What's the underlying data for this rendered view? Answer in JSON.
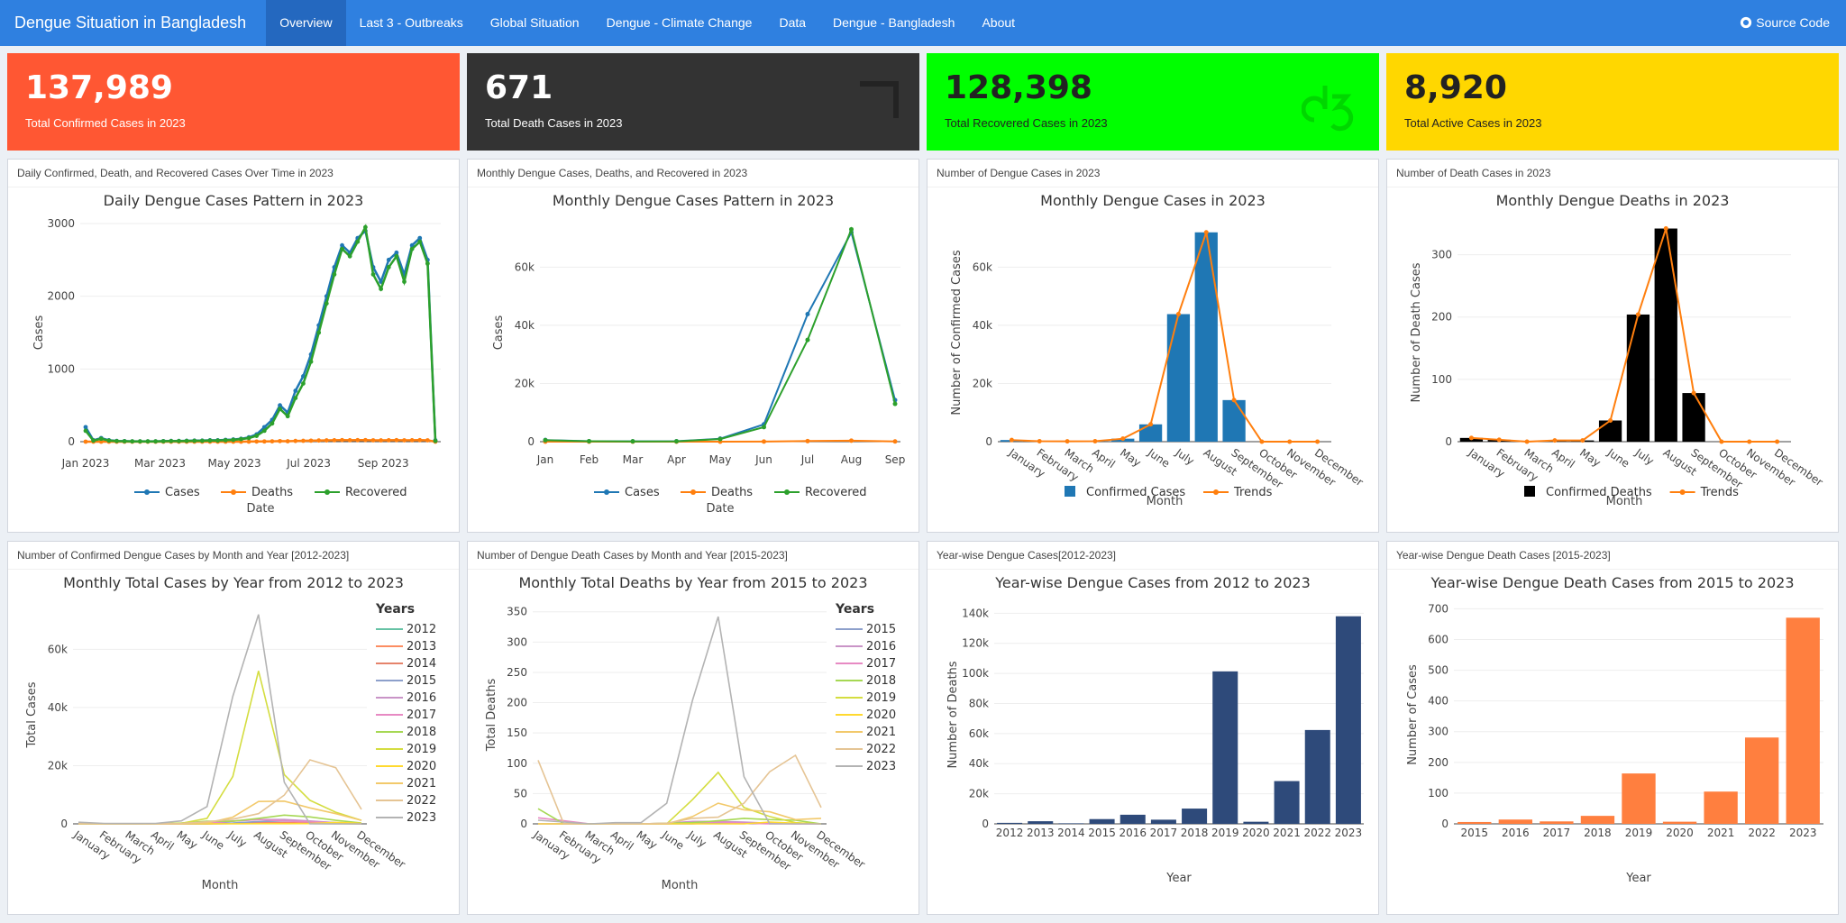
{
  "nav": {
    "brand": "Dengue Situation in Bangladesh",
    "items": [
      "Overview",
      "Last 3 - Outbreaks",
      "Global Situation",
      "Dengue - Climate Change",
      "Data",
      "Dengue - Bangladesh",
      "About"
    ],
    "source": "Source Code"
  },
  "value_boxes": [
    {
      "value": "137,989",
      "label": "Total Confirmed Cases in 2023",
      "color": "#ff5733"
    },
    {
      "value": "671",
      "label": "Total Death Cases in 2023",
      "color": "#333333"
    },
    {
      "value": "128,398",
      "label": "Total Recovered Cases in 2023",
      "color": "#00ff00"
    },
    {
      "value": "8,920",
      "label": "Total Active Cases in 2023",
      "color": "#ffd700"
    }
  ],
  "panels": [
    "Daily Confirmed, Death, and Recovered Cases Over Time in 2023",
    "Monthly Dengue Cases, Deaths, and Recovered in 2023",
    "Number of Dengue Cases in 2023",
    "Number of Death Cases in 2023",
    "Number of Confirmed Dengue Cases by Month and Year [2012-2023]",
    "Number of Dengue Death Cases by Month and Year [2015-2023]",
    "Year-wise Dengue Cases[2012-2023]",
    "Year-wise Dengue Death Cases [2015-2023]"
  ],
  "chart_data": [
    {
      "type": "line",
      "title": "Daily Dengue Cases Pattern in 2023",
      "xlabel": "Date",
      "ylabel": "Cases",
      "x_ticks": [
        "Jan 2023",
        "Mar 2023",
        "May 2023",
        "Jul 2023",
        "Sep 2023"
      ],
      "ylim": [
        0,
        3000
      ],
      "y_ticks": [
        0,
        1000,
        2000,
        3000
      ],
      "series": [
        {
          "name": "Cases",
          "color": "#1f77b4",
          "values": [
            200,
            20,
            50,
            20,
            10,
            8,
            5,
            5,
            5,
            5,
            8,
            10,
            10,
            12,
            15,
            15,
            20,
            20,
            25,
            30,
            40,
            60,
            100,
            200,
            300,
            500,
            400,
            700,
            900,
            1200,
            1600,
            2000,
            2400,
            2700,
            2600,
            2800,
            2900,
            2400,
            2200,
            2500,
            2600,
            2300,
            2700,
            2800,
            2500,
            20
          ]
        },
        {
          "name": "Deaths",
          "color": "#ff7f0e",
          "values": [
            0,
            0,
            0,
            0,
            0,
            0,
            0,
            0,
            0,
            0,
            0,
            0,
            0,
            0,
            0,
            0,
            0,
            0,
            0,
            0,
            0,
            1,
            2,
            3,
            5,
            8,
            6,
            10,
            12,
            14,
            16,
            18,
            20,
            22,
            20,
            21,
            22,
            19,
            18,
            20,
            21,
            19,
            20,
            21,
            19,
            0
          ]
        },
        {
          "name": "Recovered",
          "color": "#2ca02c",
          "values": [
            150,
            15,
            40,
            15,
            8,
            6,
            4,
            4,
            4,
            4,
            6,
            8,
            8,
            10,
            12,
            12,
            15,
            15,
            20,
            25,
            35,
            50,
            80,
            150,
            250,
            450,
            350,
            600,
            800,
            1100,
            1500,
            1900,
            2300,
            2650,
            2550,
            2750,
            2950,
            2300,
            2100,
            2400,
            2550,
            2200,
            2650,
            2750,
            2450,
            10
          ]
        }
      ]
    },
    {
      "type": "line",
      "title": "Monthly Dengue Cases Pattern in 2023",
      "xlabel": "Date",
      "ylabel": "Cases",
      "categories": [
        "Jan",
        "Feb",
        "Mar",
        "Apr",
        "May",
        "Jun",
        "Jul",
        "Aug",
        "Sep"
      ],
      "ylim": [
        0,
        75000
      ],
      "y_ticks": [
        "0",
        "20k",
        "40k",
        "60k"
      ],
      "series": [
        {
          "name": "Cases",
          "color": "#1f77b4",
          "values": [
            566,
            166,
            111,
            143,
            1036,
            5956,
            43854,
            71976,
            14300
          ]
        },
        {
          "name": "Deaths",
          "color": "#ff7f0e",
          "values": [
            6,
            3,
            0,
            2,
            2,
            34,
            204,
            342,
            78
          ]
        },
        {
          "name": "Recovered",
          "color": "#2ca02c",
          "values": [
            500,
            150,
            100,
            130,
            900,
            5000,
            35000,
            73000,
            13000
          ]
        }
      ]
    },
    {
      "type": "bar",
      "title": "Monthly Dengue Cases in 2023",
      "xlabel": "Month",
      "ylabel": "Number of Confirmed Cases",
      "categories": [
        "January",
        "February",
        "March",
        "April",
        "May",
        "June",
        "July",
        "August",
        "September",
        "October",
        "November",
        "December"
      ],
      "ylim": [
        0,
        75000
      ],
      "y_ticks": [
        "0",
        "20k",
        "40k",
        "60k"
      ],
      "values": [
        566,
        166,
        111,
        143,
        1036,
        5956,
        43854,
        71976,
        14300,
        0,
        0,
        0
      ],
      "bar_color": "#1f77b4",
      "trend_color": "#ff7f0e",
      "legend": [
        "Confirmed Cases",
        "Trends"
      ]
    },
    {
      "type": "bar",
      "title": "Monthly Dengue Deaths in 2023",
      "xlabel": "Month",
      "ylabel": "Number of Death Cases",
      "categories": [
        "January",
        "February",
        "March",
        "April",
        "May",
        "June",
        "July",
        "August",
        "September",
        "October",
        "November",
        "December"
      ],
      "ylim": [
        0,
        350
      ],
      "y_ticks": [
        "0",
        "100",
        "200",
        "300"
      ],
      "values": [
        6,
        3,
        0,
        2,
        2,
        34,
        204,
        342,
        78,
        0,
        0,
        0
      ],
      "bar_color": "#000000",
      "trend_color": "#ff7f0e",
      "legend": [
        "Confirmed Deaths",
        "Trends"
      ]
    },
    {
      "type": "line",
      "title": "Monthly Total Cases by Year from 2012 to 2023",
      "xlabel": "Month",
      "ylabel": "Total Cases",
      "legend_title": "Years",
      "categories": [
        "January",
        "February",
        "March",
        "April",
        "May",
        "June",
        "July",
        "August",
        "September",
        "October",
        "November",
        "December"
      ],
      "ylim": [
        0,
        75000
      ],
      "y_ticks": [
        "0",
        "20k",
        "40k",
        "60k"
      ],
      "series": [
        {
          "name": "2012",
          "color": "#66c2a5",
          "values": [
            0,
            0,
            0,
            0,
            0,
            0,
            100,
            300,
            200,
            100,
            50,
            20
          ]
        },
        {
          "name": "2013",
          "color": "#fc8d62",
          "values": [
            0,
            0,
            0,
            0,
            0,
            50,
            200,
            500,
            400,
            300,
            100,
            50
          ]
        },
        {
          "name": "2014",
          "color": "#e5836b",
          "values": [
            0,
            0,
            0,
            0,
            0,
            20,
            100,
            200,
            150,
            100,
            50,
            10
          ]
        },
        {
          "name": "2015",
          "color": "#8da0cb",
          "values": [
            0,
            0,
            0,
            0,
            10,
            30,
            300,
            800,
            1000,
            800,
            400,
            100
          ]
        },
        {
          "name": "2016",
          "color": "#c994c7",
          "values": [
            0,
            0,
            0,
            0,
            20,
            200,
            900,
            1500,
            1500,
            1000,
            400,
            100
          ]
        },
        {
          "name": "2017",
          "color": "#e78ac3",
          "values": [
            0,
            0,
            0,
            0,
            100,
            300,
            1000,
            1500,
            1000,
            700,
            300,
            100
          ]
        },
        {
          "name": "2018",
          "color": "#a6d854",
          "values": [
            30,
            10,
            20,
            40,
            300,
            900,
            900,
            1900,
            3000,
            2400,
            1200,
            300
          ]
        },
        {
          "name": "2019",
          "color": "#d4dd40",
          "values": [
            40,
            20,
            20,
            60,
            180,
            1900,
            16300,
            52600,
            16900,
            8100,
            4000,
            1200
          ]
        },
        {
          "name": "2020",
          "color": "#ffd92f",
          "values": [
            200,
            45,
            27,
            25,
            0,
            20,
            20,
            70,
            50,
            100,
            500,
            200
          ]
        },
        {
          "name": "2021",
          "color": "#f2c96b",
          "values": [
            30,
            10,
            10,
            0,
            40,
            270,
            2300,
            7700,
            7800,
            5500,
            3500,
            1200
          ]
        },
        {
          "name": "2022",
          "color": "#e5c494",
          "values": [
            100,
            20,
            20,
            20,
            160,
            700,
            1600,
            3500,
            9900,
            22000,
            19300,
            5000
          ]
        },
        {
          "name": "2023",
          "color": "#b3b3b3",
          "values": [
            566,
            166,
            111,
            143,
            1036,
            5956,
            43854,
            71976,
            14300,
            0,
            0,
            0
          ]
        }
      ]
    },
    {
      "type": "line",
      "title": "Monthly Total Deaths by Year from 2015 to 2023",
      "xlabel": "Month",
      "ylabel": "Total Deaths",
      "legend_title": "Years",
      "categories": [
        "January",
        "February",
        "March",
        "April",
        "May",
        "June",
        "July",
        "August",
        "September",
        "October",
        "November",
        "December"
      ],
      "ylim": [
        0,
        360
      ],
      "y_ticks": [
        "0",
        "50",
        "100",
        "150",
        "200",
        "250",
        "300",
        "350"
      ],
      "series": [
        {
          "name": "2015",
          "color": "#8da0cb",
          "values": [
            0,
            0,
            0,
            0,
            0,
            0,
            0,
            2,
            2,
            1,
            1,
            0
          ]
        },
        {
          "name": "2016",
          "color": "#c994c7",
          "values": [
            0,
            0,
            0,
            0,
            0,
            1,
            4,
            4,
            3,
            1,
            0,
            0
          ]
        },
        {
          "name": "2017",
          "color": "#e78ac3",
          "values": [
            10,
            5,
            0,
            0,
            0,
            0,
            2,
            3,
            1,
            0,
            0,
            0
          ]
        },
        {
          "name": "2018",
          "color": "#a6d854",
          "values": [
            25,
            0,
            0,
            0,
            0,
            1,
            2,
            5,
            9,
            7,
            6,
            0
          ]
        },
        {
          "name": "2019",
          "color": "#d4dd40",
          "values": [
            0,
            0,
            0,
            0,
            0,
            0,
            40,
            85,
            27,
            12,
            2,
            0
          ]
        },
        {
          "name": "2020",
          "color": "#ffd92f",
          "values": [
            0,
            0,
            0,
            0,
            0,
            0,
            0,
            0,
            0,
            3,
            1,
            0
          ]
        },
        {
          "name": "2021",
          "color": "#f2c96b",
          "values": [
            0,
            0,
            0,
            0,
            0,
            0,
            12,
            34,
            23,
            20,
            7,
            9
          ]
        },
        {
          "name": "2022",
          "color": "#e5c494",
          "values": [
            105,
            0,
            0,
            0,
            0,
            1,
            9,
            11,
            34,
            86,
            113,
            27
          ]
        },
        {
          "name": "2023",
          "color": "#b3b3b3",
          "values": [
            6,
            3,
            0,
            2,
            2,
            34,
            204,
            342,
            78,
            0,
            0,
            0
          ]
        }
      ]
    },
    {
      "type": "bar",
      "title": "Year-wise Dengue Cases from 2012 to 2023",
      "xlabel": "Year",
      "ylabel": "Number of Deaths",
      "categories": [
        "2012",
        "2013",
        "2014",
        "2015",
        "2016",
        "2017",
        "2018",
        "2019",
        "2020",
        "2021",
        "2022",
        "2023"
      ],
      "ylim": [
        0,
        145000
      ],
      "y_ticks": [
        "0",
        "20k",
        "40k",
        "60k",
        "80k",
        "100k",
        "120k",
        "140k"
      ],
      "values": [
        671,
        1749,
        375,
        3162,
        6060,
        2769,
        10148,
        101354,
        1405,
        28429,
        62382,
        137989
      ],
      "bar_color": "#2e4a7a"
    },
    {
      "type": "bar",
      "title": "Year-wise Dengue Death Cases from 2015 to 2023",
      "xlabel": "Year",
      "ylabel": "Number of Cases",
      "categories": [
        "2015",
        "2016",
        "2017",
        "2018",
        "2019",
        "2020",
        "2021",
        "2022",
        "2023"
      ],
      "ylim": [
        0,
        710
      ],
      "y_ticks": [
        "0",
        "100",
        "200",
        "300",
        "400",
        "500",
        "600",
        "700"
      ],
      "values": [
        6,
        14,
        8,
        26,
        164,
        7,
        105,
        281,
        671
      ],
      "bar_color": "#ff7f3f"
    }
  ]
}
